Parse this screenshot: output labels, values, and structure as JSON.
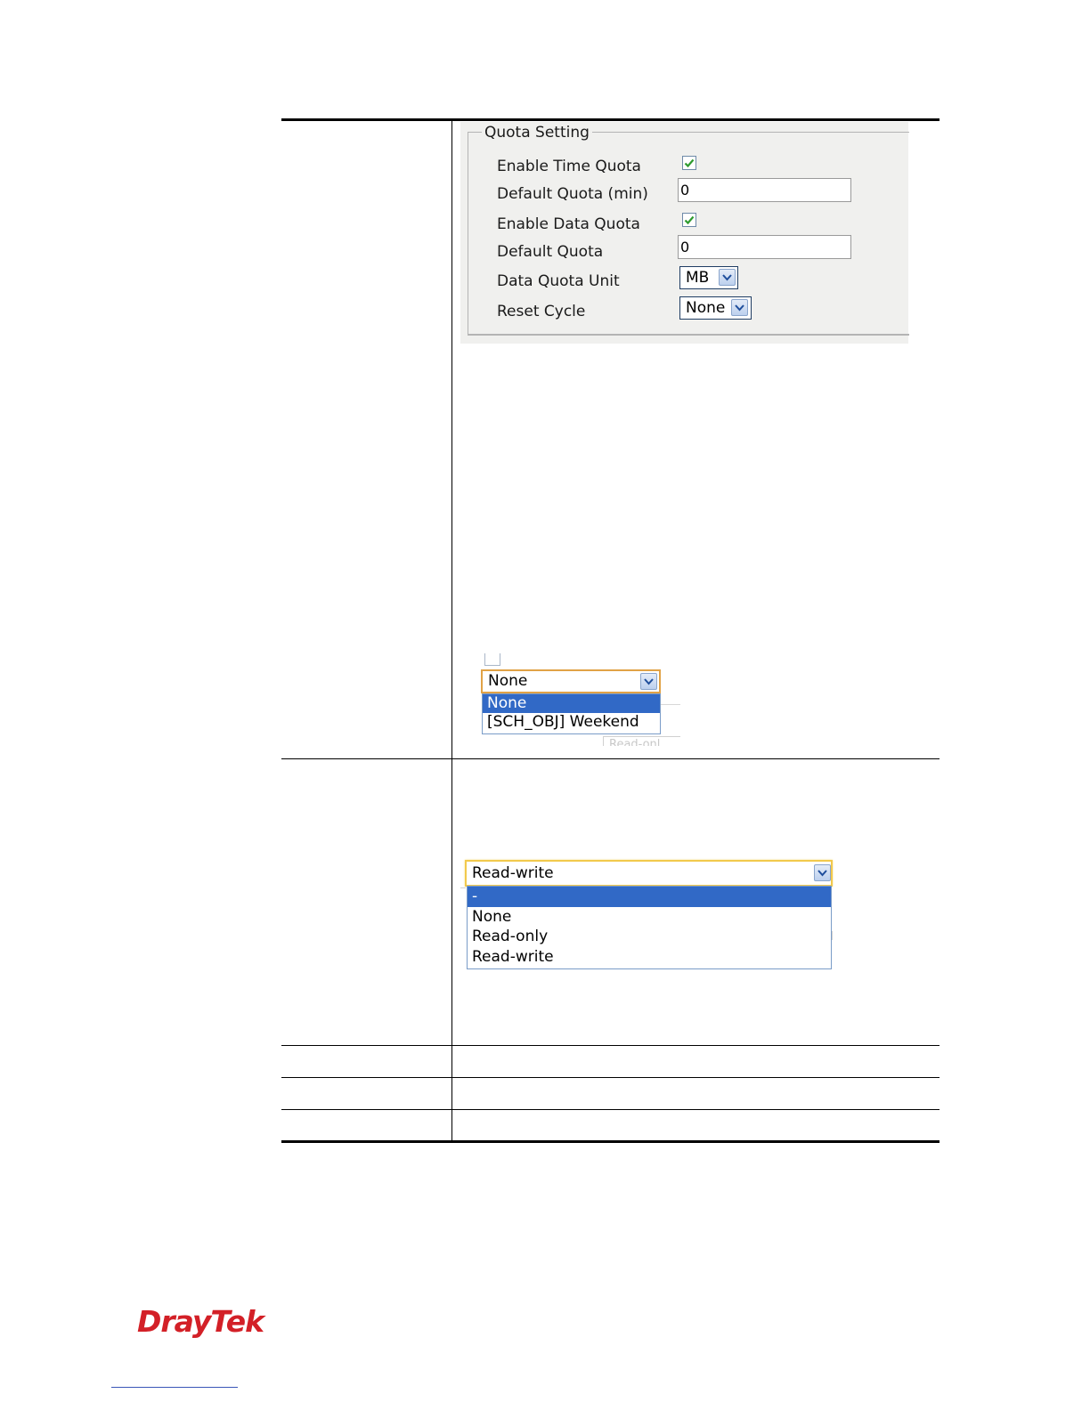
{
  "quota_setting": {
    "legend": "Quota Setting",
    "rows": {
      "enable_time_quota": {
        "label": "Enable Time Quota",
        "checked": true
      },
      "default_quota_min": {
        "label": "Default Quota (min)",
        "value": "0"
      },
      "enable_data_quota": {
        "label": "Enable Data Quota",
        "checked": true
      },
      "default_quota": {
        "label": "Default Quota",
        "value": "0"
      },
      "data_quota_unit": {
        "label": "Data Quota Unit",
        "value": "MB"
      },
      "reset_cycle": {
        "label": "Reset Cycle",
        "value": "None"
      }
    }
  },
  "schedule_dropdown": {
    "selected": "None",
    "options": [
      "None",
      "[SCH_OBJ] Weekend"
    ],
    "highlighted_index": 0,
    "background_fragment": "Read-onl"
  },
  "access_dropdown": {
    "selected": "Read-write",
    "options": [
      "-",
      "None",
      "Read-only",
      "Read-write"
    ],
    "highlighted_index": 0
  },
  "brand": {
    "logo_text": "DrayTek",
    "logo_color": "#d32027"
  },
  "colors": {
    "highlight": "#3169c6",
    "check_green": "#2e9b2e"
  }
}
